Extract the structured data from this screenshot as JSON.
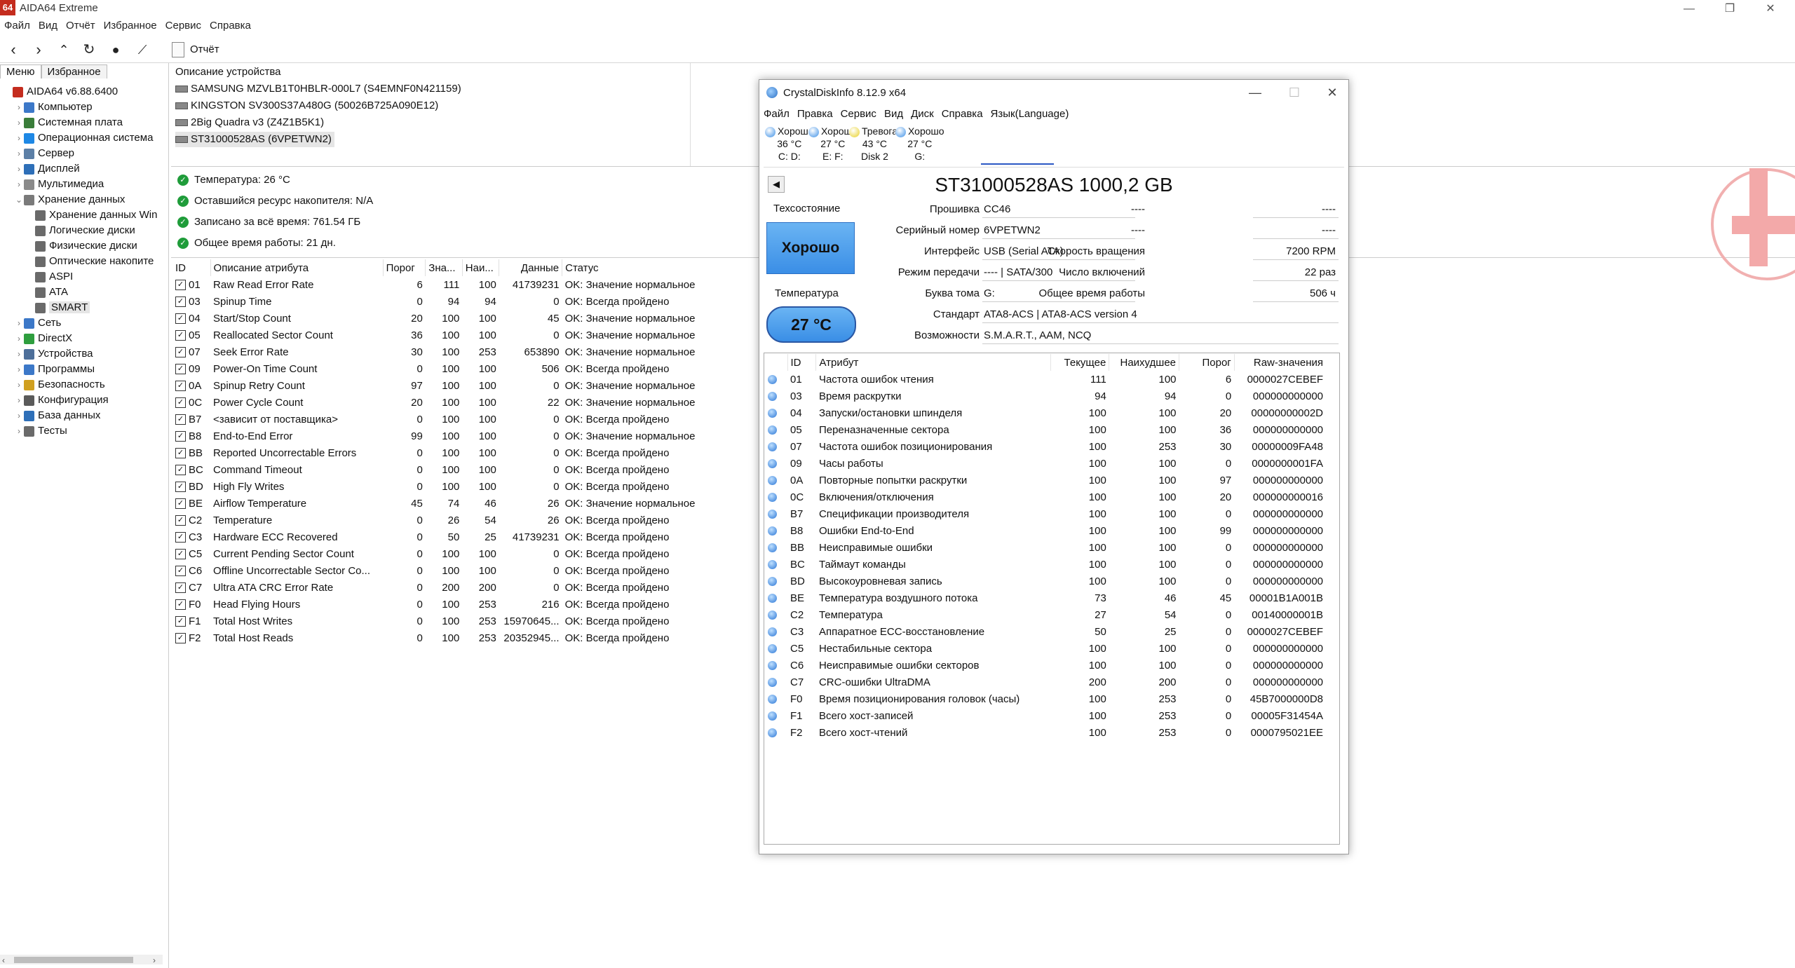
{
  "window": {
    "title": "AIDA64 Extreme",
    "icon_text": "64"
  },
  "menu": [
    "Файл",
    "Вид",
    "Отчёт",
    "Избранное",
    "Сервис",
    "Справка"
  ],
  "toolbar": {
    "report_label": "Отчёт"
  },
  "tabs": [
    "Меню",
    "Избранное"
  ],
  "tree": [
    {
      "label": "AIDA64 v6.88.6400",
      "level": 0,
      "arrow": "",
      "icon_color": "#c42c1e"
    },
    {
      "label": "Компьютер",
      "level": 1,
      "arrow": "›",
      "icon_color": "#3c78c8"
    },
    {
      "label": "Системная плата",
      "level": 1,
      "arrow": "›",
      "icon_color": "#3a7d3a"
    },
    {
      "label": "Операционная система",
      "level": 1,
      "arrow": "›",
      "icon_color": "#1e88e5"
    },
    {
      "label": "Сервер",
      "level": 1,
      "arrow": "›",
      "icon_color": "#5c7fa6"
    },
    {
      "label": "Дисплей",
      "level": 1,
      "arrow": "›",
      "icon_color": "#2e6fb8"
    },
    {
      "label": "Мультимедиа",
      "level": 1,
      "arrow": "›",
      "icon_color": "#8a8a8a"
    },
    {
      "label": "Хранение данных",
      "level": 1,
      "arrow": "⌄",
      "icon_color": "#7a7a7a"
    },
    {
      "label": "Хранение данных Win",
      "level": 2,
      "arrow": "",
      "icon_color": "#6a6a6a"
    },
    {
      "label": "Логические диски",
      "level": 2,
      "arrow": "",
      "icon_color": "#6a6a6a"
    },
    {
      "label": "Физические диски",
      "level": 2,
      "arrow": "",
      "icon_color": "#6a6a6a"
    },
    {
      "label": "Оптические накопите",
      "level": 2,
      "arrow": "",
      "icon_color": "#6a6a6a"
    },
    {
      "label": "ASPI",
      "level": 2,
      "arrow": "",
      "icon_color": "#6a6a6a"
    },
    {
      "label": "ATA",
      "level": 2,
      "arrow": "",
      "icon_color": "#6a6a6a"
    },
    {
      "label": "SMART",
      "level": 2,
      "arrow": "",
      "icon_color": "#6a6a6a",
      "selected": true
    },
    {
      "label": "Сеть",
      "level": 1,
      "arrow": "›",
      "icon_color": "#3c78c8"
    },
    {
      "label": "DirectX",
      "level": 1,
      "arrow": "›",
      "icon_color": "#2e9e3e"
    },
    {
      "label": "Устройства",
      "level": 1,
      "arrow": "›",
      "icon_color": "#4d6f9a"
    },
    {
      "label": "Программы",
      "level": 1,
      "arrow": "›",
      "icon_color": "#3c78c8"
    },
    {
      "label": "Безопасность",
      "level": 1,
      "arrow": "›",
      "icon_color": "#d0a020"
    },
    {
      "label": "Конфигурация",
      "level": 1,
      "arrow": "›",
      "icon_color": "#5a5a5a"
    },
    {
      "label": "База данных",
      "level": 1,
      "arrow": "›",
      "icon_color": "#2e6fb8"
    },
    {
      "label": "Тесты",
      "level": 1,
      "arrow": "›",
      "icon_color": "#6a6a6a"
    }
  ],
  "devices": {
    "header": "Описание устройства",
    "items": [
      {
        "label": "SAMSUNG MZVLB1T0HBLR-000L7 (S4EMNF0N421159)"
      },
      {
        "label": "KINGSTON SV300S37A480G (50026B725A090E12)"
      },
      {
        "label": "2Big Quadra v3 (Z4Z1B5K1)"
      },
      {
        "label": "ST31000528AS (6VPETWN2)",
        "selected": true
      }
    ]
  },
  "info": [
    "Температура: 26 °C",
    "Оставшийся ресурс накопителя: N/A",
    "Записано за всё время: 761.54 ГБ",
    "Общее время работы: 21 дн."
  ],
  "smart": {
    "columns": [
      "ID",
      "Описание атрибута",
      "Порог",
      "Зна...",
      "Наи...",
      "Данные",
      "Статус"
    ],
    "rows": [
      [
        "01",
        "Raw Read Error Rate",
        "6",
        "111",
        "100",
        "41739231",
        "OK: Значение нормальное"
      ],
      [
        "03",
        "Spinup Time",
        "0",
        "94",
        "94",
        "0",
        "OK: Всегда пройдено"
      ],
      [
        "04",
        "Start/Stop Count",
        "20",
        "100",
        "100",
        "45",
        "OK: Значение нормальное"
      ],
      [
        "05",
        "Reallocated Sector Count",
        "36",
        "100",
        "100",
        "0",
        "OK: Значение нормальное"
      ],
      [
        "07",
        "Seek Error Rate",
        "30",
        "100",
        "253",
        "653890",
        "OK: Значение нормальное"
      ],
      [
        "09",
        "Power-On Time Count",
        "0",
        "100",
        "100",
        "506",
        "OK: Всегда пройдено"
      ],
      [
        "0A",
        "Spinup Retry Count",
        "97",
        "100",
        "100",
        "0",
        "OK: Значение нормальное"
      ],
      [
        "0C",
        "Power Cycle Count",
        "20",
        "100",
        "100",
        "22",
        "OK: Значение нормальное"
      ],
      [
        "B7",
        "<зависит от поставщика>",
        "0",
        "100",
        "100",
        "0",
        "OK: Всегда пройдено"
      ],
      [
        "B8",
        "End-to-End Error",
        "99",
        "100",
        "100",
        "0",
        "OK: Значение нормальное"
      ],
      [
        "BB",
        "Reported Uncorrectable Errors",
        "0",
        "100",
        "100",
        "0",
        "OK: Всегда пройдено"
      ],
      [
        "BC",
        "Command Timeout",
        "0",
        "100",
        "100",
        "0",
        "OK: Всегда пройдено"
      ],
      [
        "BD",
        "High Fly Writes",
        "0",
        "100",
        "100",
        "0",
        "OK: Всегда пройдено"
      ],
      [
        "BE",
        "Airflow Temperature",
        "45",
        "74",
        "46",
        "26",
        "OK: Значение нормальное"
      ],
      [
        "C2",
        "Temperature",
        "0",
        "26",
        "54",
        "26",
        "OK: Всегда пройдено"
      ],
      [
        "C3",
        "Hardware ECC Recovered",
        "0",
        "50",
        "25",
        "41739231",
        "OK: Всегда пройдено"
      ],
      [
        "C5",
        "Current Pending Sector Count",
        "0",
        "100",
        "100",
        "0",
        "OK: Всегда пройдено"
      ],
      [
        "C6",
        "Offline Uncorrectable Sector Co...",
        "0",
        "100",
        "100",
        "0",
        "OK: Всегда пройдено"
      ],
      [
        "C7",
        "Ultra ATA CRC Error Rate",
        "0",
        "200",
        "200",
        "0",
        "OK: Всегда пройдено"
      ],
      [
        "F0",
        "Head Flying Hours",
        "0",
        "100",
        "253",
        "216",
        "OK: Всегда пройдено"
      ],
      [
        "F1",
        "Total Host Writes",
        "0",
        "100",
        "253",
        "15970645...",
        "OK: Всегда пройдено"
      ],
      [
        "F2",
        "Total Host Reads",
        "0",
        "100",
        "253",
        "20352945...",
        "OK: Всегда пройдено"
      ]
    ]
  },
  "cdi": {
    "title": "CrystalDiskInfo 8.12.9 x64",
    "menu": [
      "Файл",
      "Правка",
      "Сервис",
      "Вид",
      "Диск",
      "Справка",
      "Язык(Language)"
    ],
    "drives": [
      {
        "status": "Хорошо",
        "temp": "36 °C",
        "letter": "C: D:",
        "color": "#3a8ee6"
      },
      {
        "status": "Хорошо",
        "temp": "27 °C",
        "letter": "E: F:",
        "color": "#3a8ee6"
      },
      {
        "status": "Тревога!",
        "temp": "43 °C",
        "letter": "Disk 2",
        "color": "#e8d020"
      },
      {
        "status": "Хорошо",
        "temp": "27 °C",
        "letter": "G:",
        "color": "#3a8ee6"
      }
    ],
    "header": "ST31000528AS 1000,2 GB",
    "health_label": "Техсостояние",
    "health_value": "Хорошо",
    "temp_label": "Температура",
    "temp_value": "27 °C",
    "fields": {
      "firmware_label": "Прошивка",
      "firmware": "CC46",
      "serial_label": "Серийный номер",
      "serial": "6VPETWN2",
      "interface_label": "Интерфейс",
      "interface": "USB (Serial ATA)",
      "transfer_label": "Режим передачи",
      "transfer": "---- | SATA/300",
      "volume_label": "Буква тома",
      "volume": "G:",
      "standard_label": "Стандарт",
      "standard": "ATA8-ACS | ATA8-ACS version 4",
      "features_label": "Возможности",
      "features": "S.M.A.R.T., AAM, NCQ",
      "dash1_label": "----",
      "dash1": "----",
      "dash2_label": "----",
      "dash2": "----",
      "rotation_label": "Скорость вращения",
      "rotation": "7200 RPM",
      "power_count_label": "Число включений",
      "power_count": "22 раз",
      "power_hours_label": "Общее время работы",
      "power_hours": "506 ч"
    },
    "table": {
      "columns": [
        "",
        "ID",
        "Атрибут",
        "Текущее",
        "Наихудшее",
        "Порог",
        "Raw-значения"
      ],
      "rows": [
        [
          "01",
          "Частота ошибок чтения",
          "111",
          "100",
          "6",
          "0000027CEBEF"
        ],
        [
          "03",
          "Время раскрутки",
          "94",
          "94",
          "0",
          "000000000000"
        ],
        [
          "04",
          "Запуски/остановки шпинделя",
          "100",
          "100",
          "20",
          "00000000002D"
        ],
        [
          "05",
          "Переназначенные сектора",
          "100",
          "100",
          "36",
          "000000000000"
        ],
        [
          "07",
          "Частота ошибок позиционирования",
          "100",
          "253",
          "30",
          "00000009FA48"
        ],
        [
          "09",
          "Часы работы",
          "100",
          "100",
          "0",
          "0000000001FA"
        ],
        [
          "0A",
          "Повторные попытки раскрутки",
          "100",
          "100",
          "97",
          "000000000000"
        ],
        [
          "0C",
          "Включения/отключения",
          "100",
          "100",
          "20",
          "000000000016"
        ],
        [
          "B7",
          "Спецификации производителя",
          "100",
          "100",
          "0",
          "000000000000"
        ],
        [
          "B8",
          "Ошибки End-to-End",
          "100",
          "100",
          "99",
          "000000000000"
        ],
        [
          "BB",
          "Неисправимые ошибки",
          "100",
          "100",
          "0",
          "000000000000"
        ],
        [
          "BC",
          "Таймаут команды",
          "100",
          "100",
          "0",
          "000000000000"
        ],
        [
          "BD",
          "Высокоуровневая запись",
          "100",
          "100",
          "0",
          "000000000000"
        ],
        [
          "BE",
          "Температура воздушного потока",
          "73",
          "46",
          "45",
          "00001B1A001B"
        ],
        [
          "C2",
          "Температура",
          "27",
          "54",
          "0",
          "00140000001B"
        ],
        [
          "C3",
          "Аппаратное ECC-восстановление",
          "50",
          "25",
          "0",
          "0000027CEBEF"
        ],
        [
          "C5",
          "Нестабильные сектора",
          "100",
          "100",
          "0",
          "000000000000"
        ],
        [
          "C6",
          "Неисправимые ошибки секторов",
          "100",
          "100",
          "0",
          "000000000000"
        ],
        [
          "C7",
          "CRC-ошибки UltraDMA",
          "200",
          "200",
          "0",
          "000000000000"
        ],
        [
          "F0",
          "Время позиционирования головок (часы)",
          "100",
          "253",
          "0",
          "45B7000000D8"
        ],
        [
          "F1",
          "Всего хост-записей",
          "100",
          "253",
          "0",
          "00005F31454A"
        ],
        [
          "F2",
          "Всего хост-чтений",
          "100",
          "253",
          "0",
          "0000795021EE"
        ]
      ]
    }
  }
}
